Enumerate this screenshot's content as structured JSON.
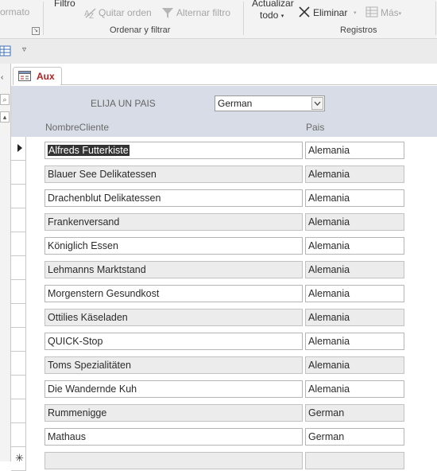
{
  "ribbon": {
    "formato_partial": "ormato",
    "filtro": "Filtro",
    "quitar_orden": "Quitar orden",
    "alternar_filtro": "Alternar filtro",
    "group_ordenar": "Ordenar y filtrar",
    "actualizar_l1": "Actualizar",
    "actualizar_l2": "todo",
    "eliminar": "Eliminar",
    "mas": "Más",
    "group_registros": "Registros"
  },
  "tab": {
    "label": "Aux"
  },
  "form": {
    "filter_label": "ELIJA UN PAIS",
    "selected_country": "German",
    "col_name": "NombreCliente",
    "col_country": "Pais"
  },
  "records": [
    {
      "name": "Alfreds Futterkiste",
      "country": "Alemania"
    },
    {
      "name": "Blauer See Delikatessen",
      "country": "Alemania"
    },
    {
      "name": "Drachenblut Delikatessen",
      "country": "Alemania"
    },
    {
      "name": "Frankenversand",
      "country": "Alemania"
    },
    {
      "name": "Königlich Essen",
      "country": "Alemania"
    },
    {
      "name": "Lehmanns Marktstand",
      "country": "Alemania"
    },
    {
      "name": "Morgenstern Gesundkost",
      "country": "Alemania"
    },
    {
      "name": "Ottilies Käseladen",
      "country": "Alemania"
    },
    {
      "name": "QUICK-Stop",
      "country": "Alemania"
    },
    {
      "name": "Toms Spezialitäten",
      "country": "Alemania"
    },
    {
      "name": "Die Wandernde Kuh",
      "country": "Alemania"
    },
    {
      "name": "Rummenigge",
      "country": "German"
    },
    {
      "name": "Mathaus",
      "country": "German"
    },
    {
      "name": "",
      "country": ""
    }
  ]
}
